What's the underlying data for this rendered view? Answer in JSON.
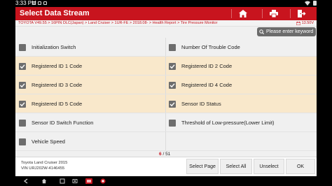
{
  "status_bar": {
    "time": "3:33 PM"
  },
  "title_bar": {
    "title": "Select Data Stream"
  },
  "breadcrumb": {
    "path": "TOYOTA V49.55 > 16PIN DLC(Japan) > Land Cruiser > 1UR-FE > 2018.08- > Health Report > Tire Pressure Monitor",
    "voltage": "13.50V"
  },
  "search": {
    "placeholder": "Please enter keyword"
  },
  "items": [
    {
      "left": {
        "label": "Initialization Switch",
        "checked": false
      },
      "right": {
        "label": "Number Of Trouble Code",
        "checked": false
      }
    },
    {
      "left": {
        "label": "Registered ID 1 Code",
        "checked": true
      },
      "right": {
        "label": "Registered ID 2 Code",
        "checked": true
      }
    },
    {
      "left": {
        "label": "Registered ID 3 Code",
        "checked": true
      },
      "right": {
        "label": "Registered ID 4 Code",
        "checked": true
      }
    },
    {
      "left": {
        "label": "Registered ID 5 Code",
        "checked": true
      },
      "right": {
        "label": "Sensor ID Status",
        "checked": true
      }
    },
    {
      "left": {
        "label": "Sensor ID Switch Function",
        "checked": false
      },
      "right": {
        "label": "Threshold of Low-pressure(Lower Limit)",
        "checked": false
      }
    },
    {
      "left": {
        "label": "Vehicle Speed",
        "checked": false
      },
      "right": {
        "label": "",
        "checked": false
      }
    }
  ],
  "pager": {
    "selected": "6",
    "total": "51",
    "separator": "/ "
  },
  "vehicle": {
    "model": "Toyota Land Cruiser 2015",
    "vin": "VIN URJ202W-4146455"
  },
  "buttons": {
    "select_page": "Select Page",
    "select_all": "Select All",
    "unselect": "Unselect",
    "ok": "OK"
  },
  "colors": {
    "accent": "#c8141e",
    "selected_row": "#f9e8cb",
    "checkbox": "#6d6d6d"
  },
  "icons": [
    "home-icon",
    "print-icon",
    "exit-icon",
    "search-icon",
    "battery-icon",
    "back-icon",
    "home-nav-icon",
    "recents-icon"
  ]
}
